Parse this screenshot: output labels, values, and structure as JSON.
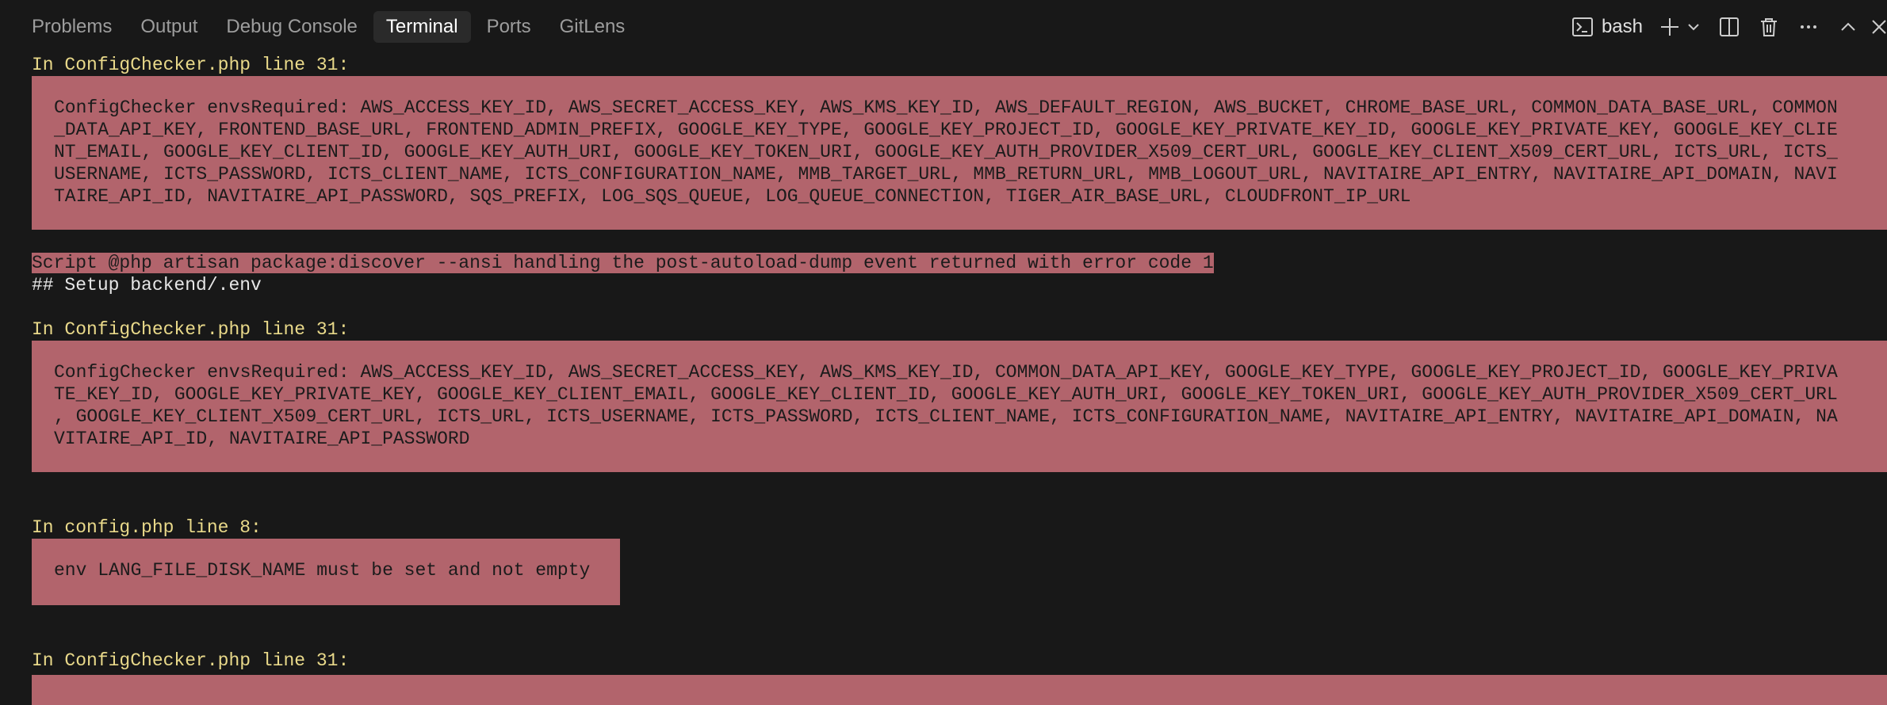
{
  "panel": {
    "tabs": [
      {
        "label": "Problems"
      },
      {
        "label": "Output"
      },
      {
        "label": "Debug Console"
      },
      {
        "label": "Terminal",
        "active": true
      },
      {
        "label": "Ports"
      },
      {
        "label": "GitLens"
      }
    ],
    "terminal_name": "bash",
    "icons": [
      "terminal-icon",
      "plus-icon",
      "chevron-down-icon",
      "split-icon",
      "trash-icon",
      "more-icon",
      "chevron-up-icon",
      "close-icon"
    ]
  },
  "terminal": {
    "heading_1": "In ConfigChecker.php line 31:",
    "error_1": [
      "ConfigChecker envsRequired: AWS_ACCESS_KEY_ID, AWS_SECRET_ACCESS_KEY, AWS_KMS_KEY_ID, AWS_DEFAULT_REGION, AWS_BUCKET, CHROME_BASE_URL, COMMON_DATA_BASE_URL, COMMON",
      "_DATA_API_KEY, FRONTEND_BASE_URL, FRONTEND_ADMIN_PREFIX, GOOGLE_KEY_TYPE, GOOGLE_KEY_PROJECT_ID, GOOGLE_KEY_PRIVATE_KEY_ID, GOOGLE_KEY_PRIVATE_KEY, GOOGLE_KEY_CLIE",
      "NT_EMAIL, GOOGLE_KEY_CLIENT_ID, GOOGLE_KEY_AUTH_URI, GOOGLE_KEY_TOKEN_URI, GOOGLE_KEY_AUTH_PROVIDER_X509_CERT_URL, GOOGLE_KEY_CLIENT_X509_CERT_URL, ICTS_URL, ICTS_",
      "USERNAME, ICTS_PASSWORD, ICTS_CLIENT_NAME, ICTS_CONFIGURATION_NAME, MMB_TARGET_URL, MMB_RETURN_URL, MMB_LOGOUT_URL, NAVITAIRE_API_ENTRY, NAVITAIRE_API_DOMAIN, NAVI",
      "TAIRE_API_ID, NAVITAIRE_API_PASSWORD, SQS_PREFIX, LOG_SQS_QUEUE, LOG_QUEUE_CONNECTION, TIGER_AIR_BASE_URL, CLOUDFRONT_IP_URL"
    ],
    "script_error": "Script @php artisan package:discover --ansi handling the post-autoload-dump event returned with error code 1",
    "setup_line": "## Setup backend/.env",
    "heading_2": "In ConfigChecker.php line 31:",
    "error_2": [
      "ConfigChecker envsRequired: AWS_ACCESS_KEY_ID, AWS_SECRET_ACCESS_KEY, AWS_KMS_KEY_ID, COMMON_DATA_API_KEY, GOOGLE_KEY_TYPE, GOOGLE_KEY_PROJECT_ID, GOOGLE_KEY_PRIVA",
      "TE_KEY_ID, GOOGLE_KEY_PRIVATE_KEY, GOOGLE_KEY_CLIENT_EMAIL, GOOGLE_KEY_CLIENT_ID, GOOGLE_KEY_AUTH_URI, GOOGLE_KEY_TOKEN_URI, GOOGLE_KEY_AUTH_PROVIDER_X509_CERT_URL",
      ", GOOGLE_KEY_CLIENT_X509_CERT_URL, ICTS_URL, ICTS_USERNAME, ICTS_PASSWORD, ICTS_CLIENT_NAME, ICTS_CONFIGURATION_NAME, NAVITAIRE_API_ENTRY, NAVITAIRE_API_DOMAIN, NA",
      "VITAIRE_API_ID, NAVITAIRE_API_PASSWORD"
    ],
    "heading_3": "In config.php line 8:",
    "error_3": [
      "env LANG_FILE_DISK_NAME must be set and not empty"
    ],
    "heading_4": "In ConfigChecker.php line 31:"
  },
  "colors": {
    "background": "#181818",
    "error_bg": "#b2646c",
    "heading": "#e9d98a",
    "active_tab_bg": "#2a2a2a"
  }
}
